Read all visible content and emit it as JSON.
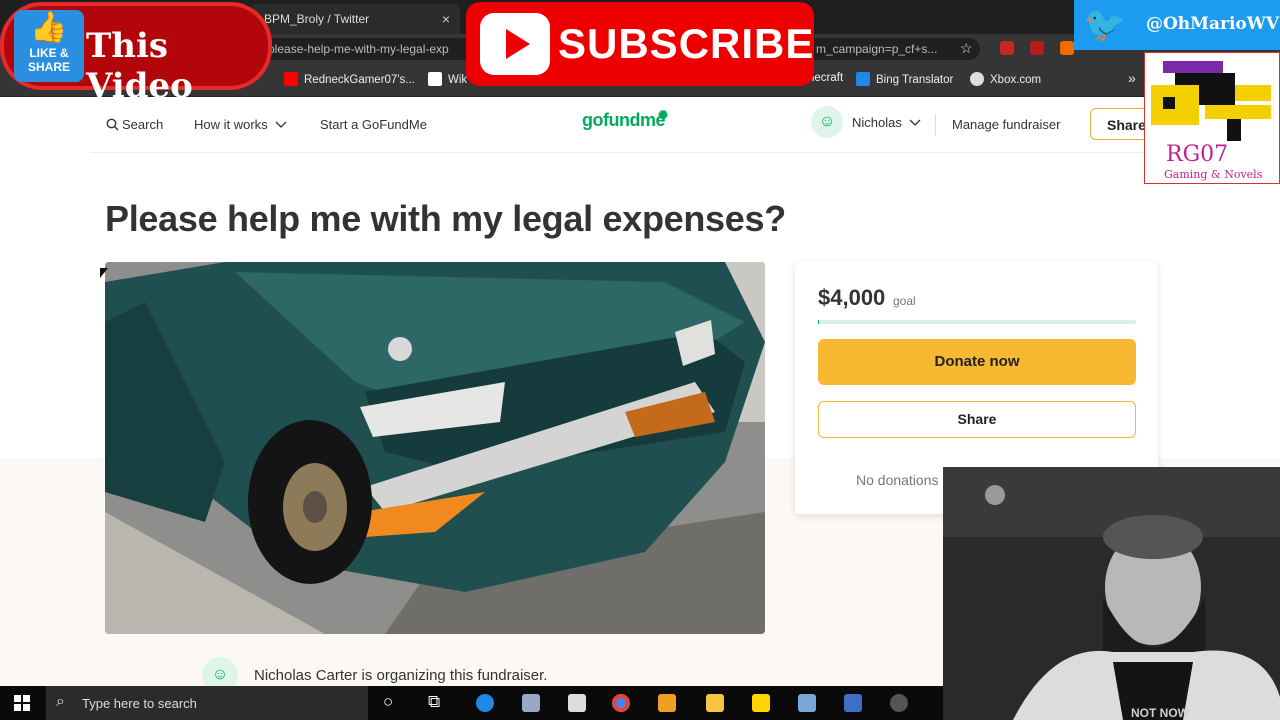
{
  "browser": {
    "tab_title": "BPM_Broly / Twitter",
    "tab_close": "×",
    "url_left": "please-help-me-with-my-legal-exp",
    "url_right": "m_campaign=p_cf+s...",
    "star": "☆"
  },
  "bookmarks": [
    {
      "label": "RedneckGamer07's...",
      "color": "#ff0000"
    },
    {
      "label": "Wik",
      "color": "#ffffff"
    },
    {
      "label": "necraft",
      "color": "#6aa84f"
    },
    {
      "label": "Bing Translator",
      "color": "#1e88e5"
    },
    {
      "label": "Xbox.com",
      "color": "#dddddd"
    }
  ],
  "overlays": {
    "like_icon_text": "LIKE & SHARE",
    "like_text": "This Video",
    "subscribe_text": "SUBSCRIBE",
    "twitter_handle": "@OhMarioWV",
    "logo_title": "RG07",
    "logo_subtitle": "Gaming & Novels"
  },
  "nav": {
    "search_label": "Search",
    "how_it_works": "How it works",
    "start_label": "Start a GoFundMe",
    "brand": "gofundme",
    "user_name": "Nicholas",
    "manage_label": "Manage fundraiser",
    "share_label": "Share"
  },
  "campaign": {
    "title": "Please help me with my legal expenses?",
    "amount": "$4,000",
    "goal_label": "goal",
    "progress": 0.003,
    "donate_label": "Donate now",
    "share_label": "Share",
    "no_donations": "No donations",
    "organizer_text": "Nicholas Carter is organizing this fundraiser."
  },
  "taskbar": {
    "search_placeholder": "Type here to search"
  },
  "colors": {
    "brand_green": "#02a95c",
    "donate_yellow": "#f8b832",
    "youtube_red": "#e00000",
    "twitter_blue": "#1d9bf0"
  }
}
